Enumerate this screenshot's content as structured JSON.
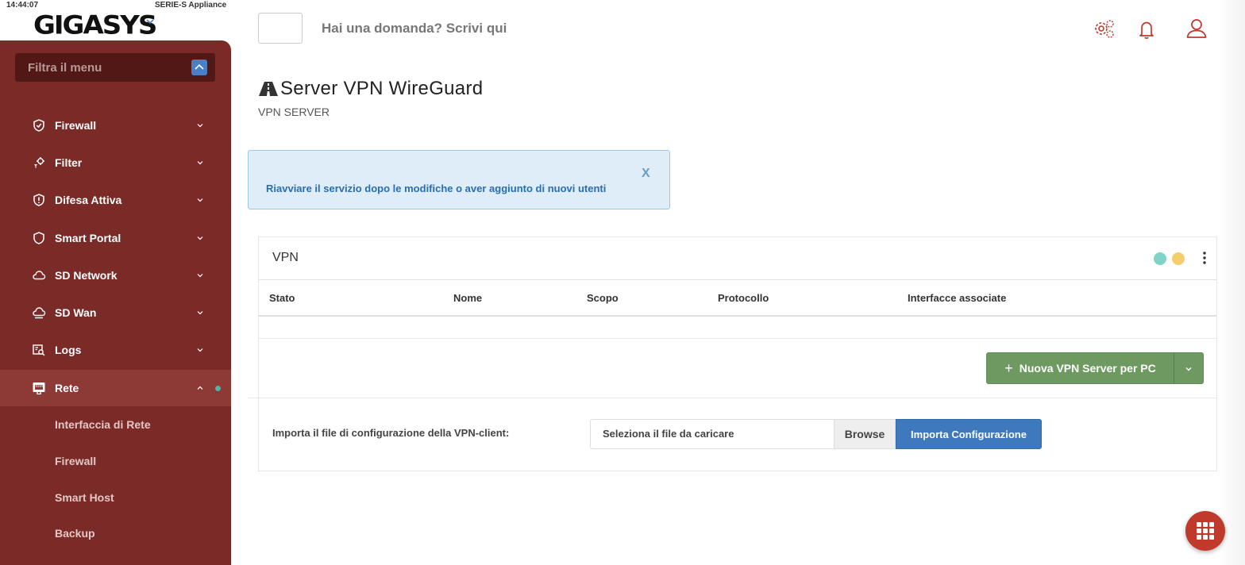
{
  "status_bar": {
    "time": "14:44:07",
    "appliance": "SERIE-S Appliance"
  },
  "brand": {
    "logo_text": "GIGASYS"
  },
  "sidebar": {
    "filter_placeholder": "Filtra il menu",
    "items": [
      {
        "label": "Firewall",
        "icon": "shield-check-icon"
      },
      {
        "label": "Filter",
        "icon": "filter-gear-icon"
      },
      {
        "label": "Difesa Attiva",
        "icon": "shield-alert-icon"
      },
      {
        "label": "Smart Portal",
        "icon": "shield-icon"
      },
      {
        "label": "SD Network",
        "icon": "cloud-icon"
      },
      {
        "label": "SD Wan",
        "icon": "cloud-speed-icon"
      },
      {
        "label": "Logs",
        "icon": "log-search-icon"
      },
      {
        "label": "Rete",
        "icon": "network-icon",
        "active": true
      }
    ],
    "subitems": [
      {
        "label": "Interfaccia di Rete"
      },
      {
        "label": "Firewall"
      },
      {
        "label": "Smart Host"
      },
      {
        "label": "Backup"
      }
    ]
  },
  "header": {
    "question_placeholder": "Hai una domanda? Scrivi qui",
    "icons": [
      "settings-icon",
      "bell-icon",
      "user-icon"
    ]
  },
  "page": {
    "title": "Server VPN WireGuard",
    "subtitle": "VPN SERVER",
    "title_icon": "road-icon"
  },
  "alert": {
    "text": "Riavviare il servizio dopo le modifiche o aver aggiunto di nuovi utenti",
    "close": "X"
  },
  "panel": {
    "title": "VPN",
    "status_dots": [
      "#7fd3c9",
      "#f6cd6b"
    ],
    "columns": [
      "Stato",
      "Nome",
      "Scopo",
      "Protocollo",
      "Interfacce associate"
    ],
    "rows": [],
    "new_button": "Nuova VPN Server per PC",
    "import_label": "Importa il file di configurazione della VPN-client:",
    "file_placeholder": "Seleziona il file da caricare",
    "browse": "Browse",
    "import_button": "Importa Configurazione"
  },
  "colors": {
    "sidebar": "#7a2b28",
    "accent_red": "#c0392b",
    "primary": "#3f79bd",
    "success": "#6e9a62"
  }
}
